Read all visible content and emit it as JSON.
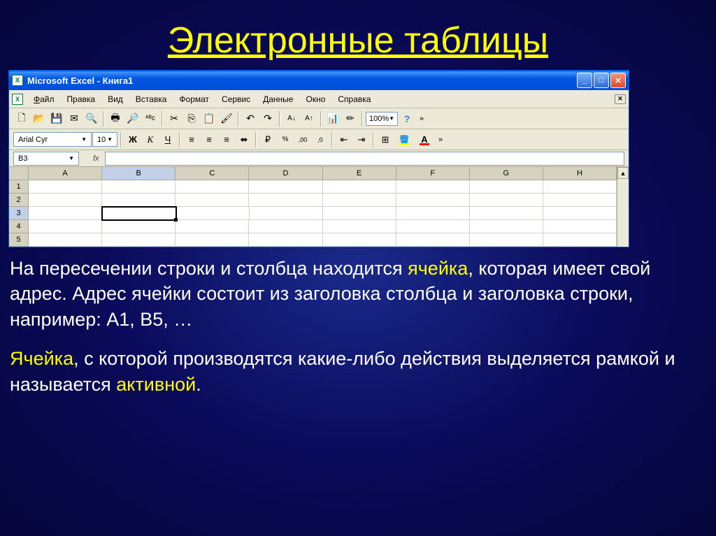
{
  "slide": {
    "title": "Электронные таблицы"
  },
  "window": {
    "title": "Microsoft Excel - Книга1"
  },
  "menu": {
    "file": "Файл",
    "edit": "Правка",
    "view": "Вид",
    "insert": "Вставка",
    "format": "Формат",
    "tools": "Сервис",
    "data": "Данные",
    "window": "Окно",
    "help": "Справка"
  },
  "toolbar": {
    "zoom": "100%"
  },
  "format_bar": {
    "font": "Arial Cyr",
    "size": "10"
  },
  "namebox": {
    "cell_ref": "B3",
    "fx": "fx"
  },
  "columns": [
    "A",
    "B",
    "C",
    "D",
    "E",
    "F",
    "G",
    "H"
  ],
  "rows": [
    "1",
    "2",
    "3",
    "4",
    "5"
  ],
  "active_cell": "B3",
  "paragraph1": {
    "p1": "На пересечении строки и столбца находится ",
    "hl1": "ячейка",
    "p2": ", которая имеет свой адрес. Адрес ячейки состоит из заголовка столбца  и заголовка строки, например: А1, В5, …"
  },
  "paragraph2": {
    "hl1": "Ячейка",
    "p1": ",  с которой производятся какие-либо действия выделяется рамкой и называется ",
    "hl2": "активной",
    "p2": "."
  }
}
